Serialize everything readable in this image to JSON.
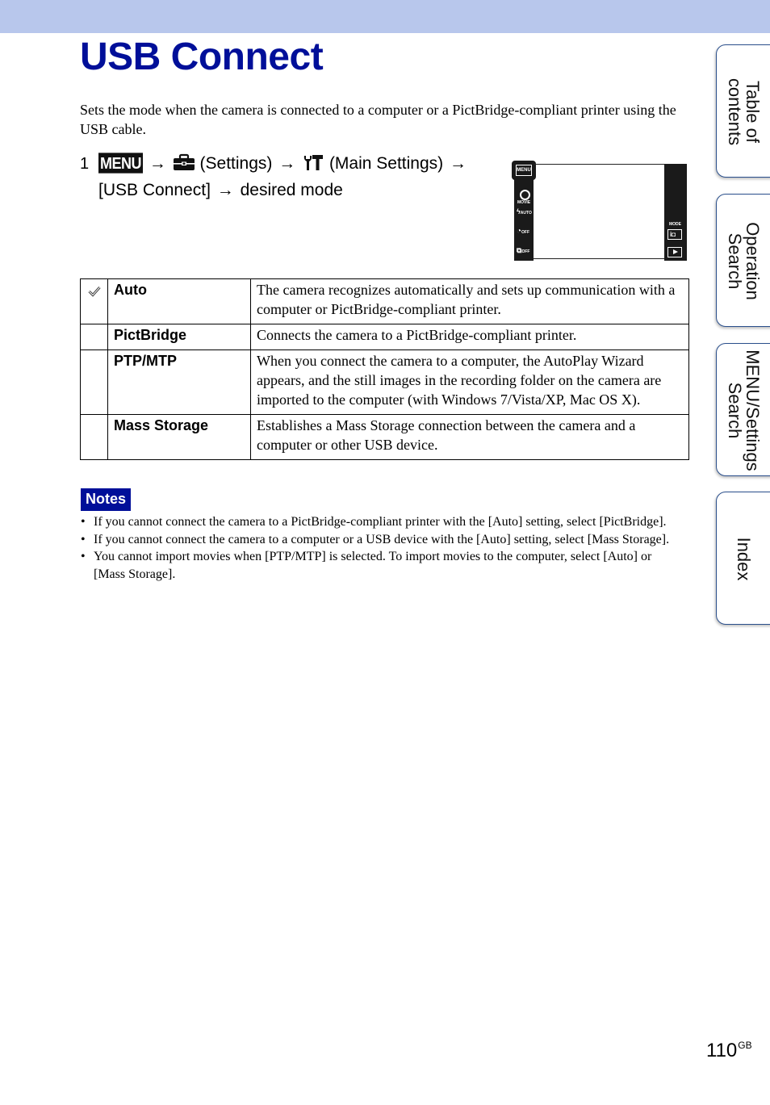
{
  "page": {
    "title": "USB Connect",
    "intro": "Sets the mode when the camera is connected to a computer or a PictBridge-compliant printer using the USB cable.",
    "page_number": "110",
    "page_suffix": "GB",
    "band_color": "#b8c7ec",
    "accent_color": "#000f99"
  },
  "step": {
    "number": "1",
    "menu_label": "MENU",
    "arrow": "→",
    "settings_text": "(Settings)",
    "main_settings_text": "(Main Settings)",
    "usb_connect_text": "[USB Connect]",
    "desired_mode_text": "desired mode",
    "icons": [
      "menu-button-icon",
      "toolbox-settings-icon",
      "wrench-hammer-main-settings-icon"
    ]
  },
  "camera_screen": {
    "menu_label": "MENU",
    "left_icons": [
      "MOVIE",
      "AUTO",
      "OFF",
      "OFF"
    ],
    "mode_label": "MODE",
    "mode_icon": "i"
  },
  "table": {
    "rows": [
      {
        "default": true,
        "name": "Auto",
        "description": "The camera recognizes automatically and sets up communication with a computer or PictBridge-compliant printer."
      },
      {
        "default": false,
        "name": "PictBridge",
        "description": "Connects the camera to a PictBridge-compliant printer."
      },
      {
        "default": false,
        "name": "PTP/MTP",
        "description": "When you connect the camera to a computer, the AutoPlay Wizard appears, and the still images in the recording folder on the camera are imported to the computer (with Windows 7/Vista/XP, Mac OS X)."
      },
      {
        "default": false,
        "name": "Mass Storage",
        "description": "Establishes a Mass Storage connection between the camera and a computer or other USB device."
      }
    ]
  },
  "notes": {
    "label": "Notes",
    "items": [
      "If you cannot connect the camera to a PictBridge-compliant printer with the [Auto] setting, select [PictBridge].",
      "If you cannot connect the camera to a computer or a USB device with the [Auto] setting, select [Mass Storage].",
      "You cannot import movies when [PTP/MTP] is selected. To import movies to the computer, select [Auto] or [Mass Storage]."
    ]
  },
  "side_tabs": [
    {
      "line1": "Table of",
      "line2": "contents"
    },
    {
      "line1": "Operation",
      "line2": "Search"
    },
    {
      "line1": "MENU/Settings",
      "line2": "Search"
    },
    {
      "line1": "Index",
      "line2": ""
    }
  ]
}
